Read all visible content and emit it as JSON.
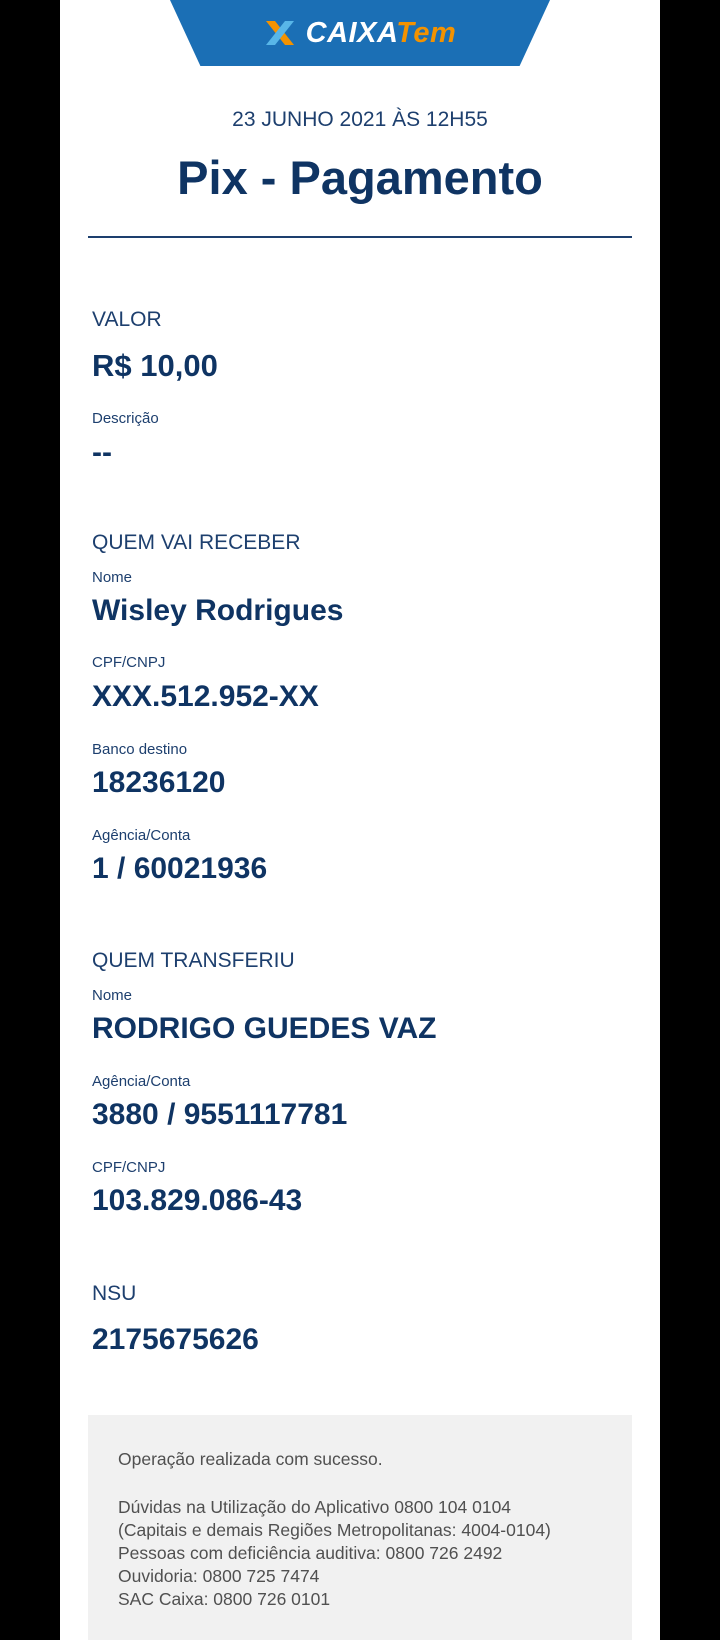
{
  "logo": {
    "brand": "CAIXA",
    "suffix": "Tem",
    "icon": "caixa-x-icon",
    "colors": {
      "blue": "#1b6fb5",
      "orange": "#f39200",
      "light_blue": "#58b6e8"
    }
  },
  "header": {
    "date": "23 JUNHO 2021 ÀS 12H55",
    "title": "Pix - Pagamento"
  },
  "valor": {
    "heading": "VALOR",
    "amount": "R$ 10,00",
    "descricao_label": "Descrição",
    "descricao_value": "--"
  },
  "recebedor": {
    "heading": "QUEM VAI RECEBER",
    "nome_label": "Nome",
    "nome": "Wisley Rodrigues",
    "cpf_label": "CPF/CNPJ",
    "cpf": "XXX.512.952-XX",
    "banco_label": "Banco destino",
    "banco": "18236120",
    "conta_label": "Agência/Conta",
    "conta": "1 / 60021936"
  },
  "pagador": {
    "heading": "QUEM TRANSFERIU",
    "nome_label": "Nome",
    "nome": "RODRIGO GUEDES VAZ",
    "conta_label": "Agência/Conta",
    "conta": "3880 / 9551117781",
    "cpf_label": "CPF/CNPJ",
    "cpf": "103.829.086-43"
  },
  "nsu": {
    "heading": "NSU",
    "value": "2175675626"
  },
  "footer": {
    "status": "Operação realizada com sucesso.",
    "lines": [
      "Dúvidas na Utilização do Aplicativo 0800 104 0104",
      "(Capitais e demais Regiões Metropolitanas: 4004-0104)",
      "Pessoas com deficiência auditiva: 0800 726 2492",
      "Ouvidoria: 0800 725 7474",
      "SAC Caixa: 0800 726 0101"
    ]
  }
}
